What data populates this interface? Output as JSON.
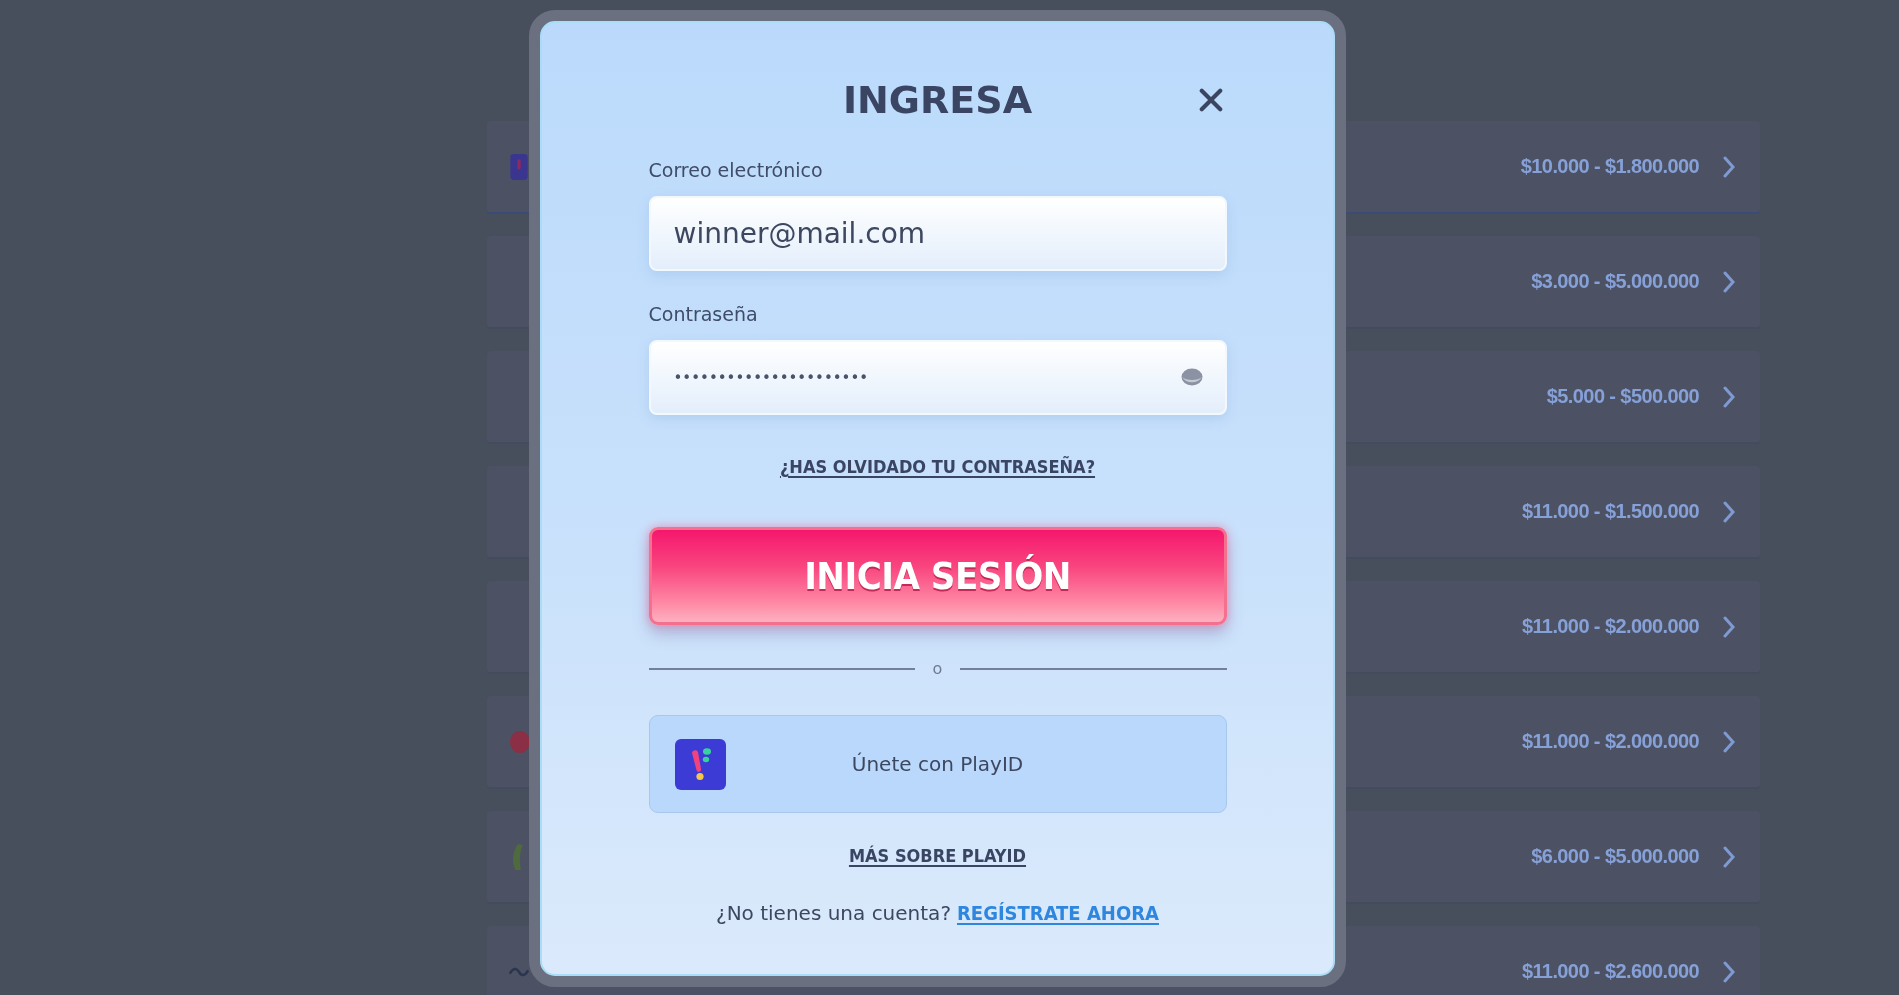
{
  "background_offers": [
    {
      "kind": "tile",
      "range": "$10.000 - $1.800.000"
    },
    {
      "range": "$3.000 - $5.000.000"
    },
    {
      "range": "$5.000 - $500.000"
    },
    {
      "range": "$11.000 - $1.500.000"
    },
    {
      "range": "$11.000 - $2.000.000"
    },
    {
      "kind": "dot",
      "range": "$11.000 - $2.000.000"
    },
    {
      "kind": "leaf",
      "range": "$6.000 - $5.000.000"
    },
    {
      "kind": "wave",
      "range": "$11.000 - $2.600.000"
    }
  ],
  "login_dialog": {
    "title": "INGRESA",
    "fields": [
      {
        "kind": "email",
        "label": "Correo electrónico",
        "value": "winner@mail.com"
      },
      {
        "kind": "password",
        "label": "Contraseña",
        "value": "••••••••••••••••••••••"
      }
    ],
    "forgot_link": "¿HAS OLVIDADO TU CONTRASEÑA?",
    "submit_button": "INICIA SESIÓN",
    "separator": "o",
    "playid_button": "Únete con PlayID",
    "more_link": "MÁS SOBRE PLAYID",
    "signup_prompt": "¿No tienes una cuenta?",
    "signup_link": "REGÍSTRATE AHORA"
  }
}
